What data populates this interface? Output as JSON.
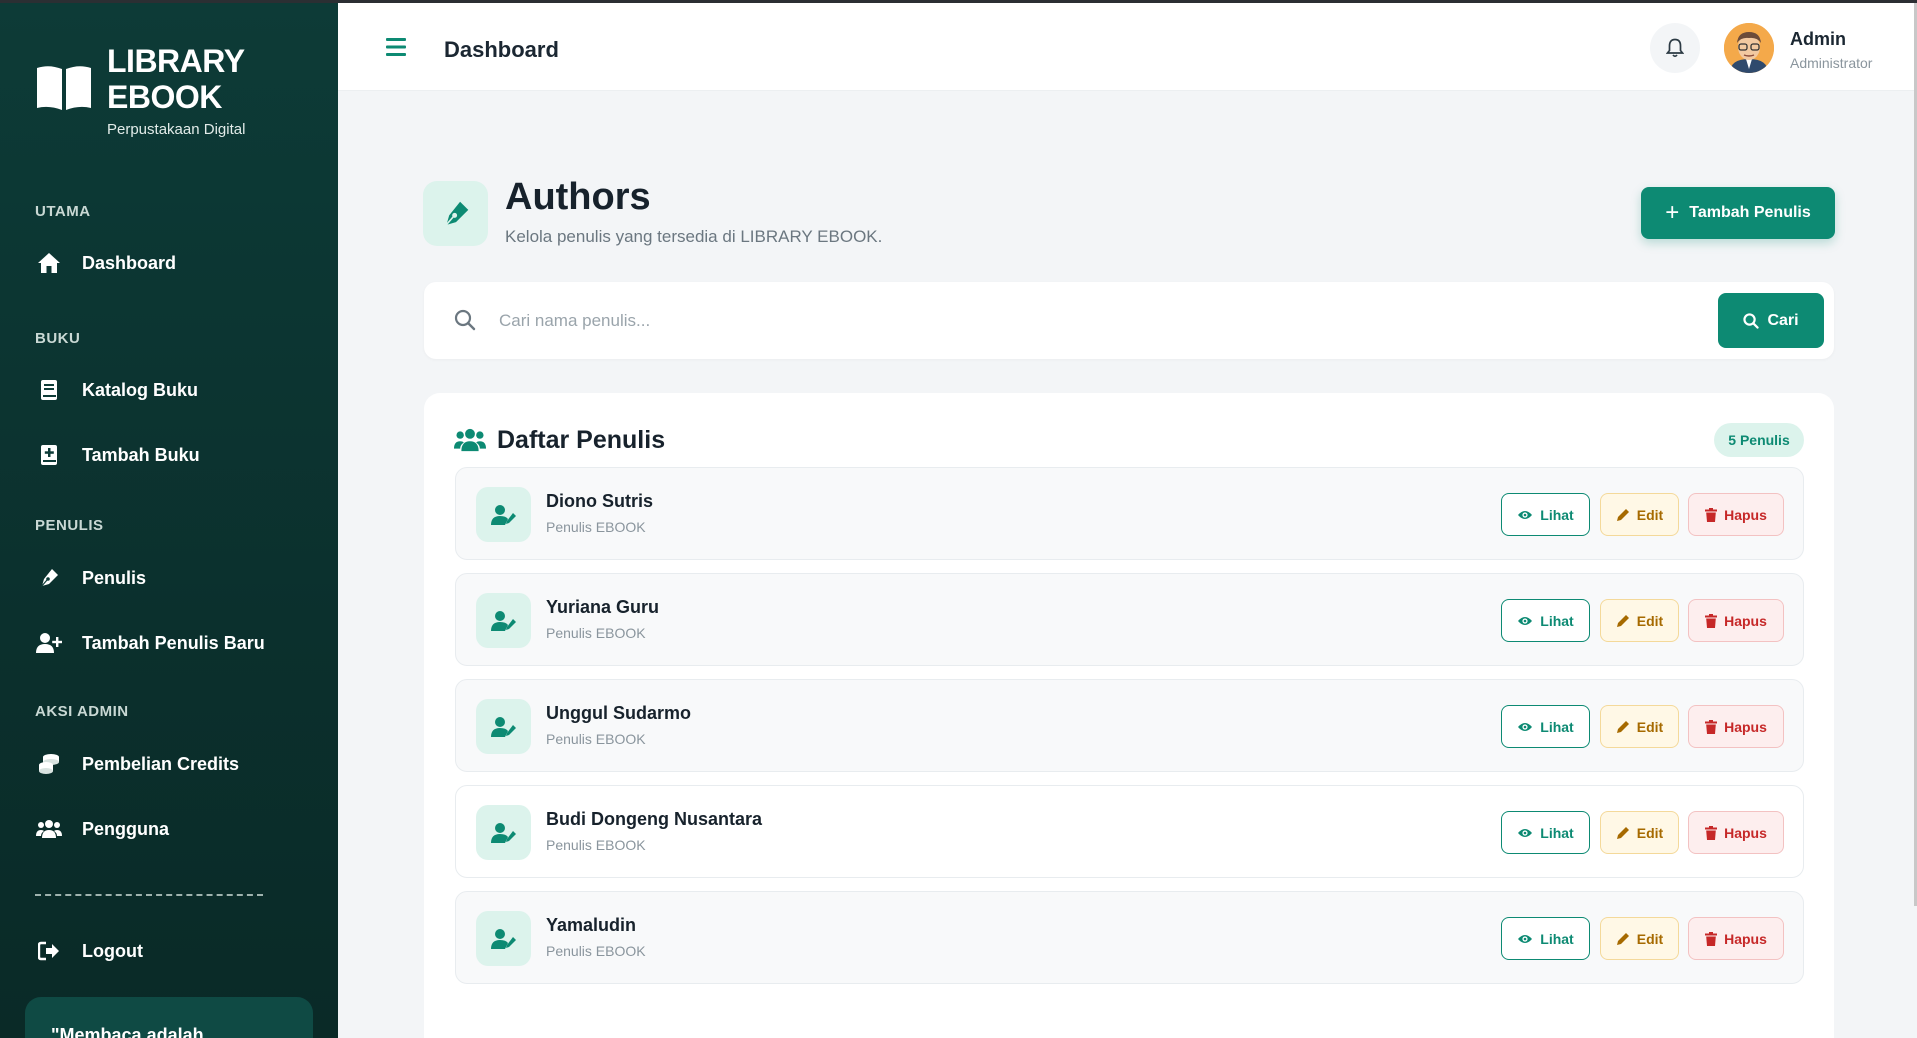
{
  "brand": {
    "title": "LIBRARY\nEBOOK",
    "subtitle": "Perpustakaan Digital"
  },
  "sidebar": {
    "sections": [
      {
        "label": "UTAMA"
      },
      {
        "label": "BUKU"
      },
      {
        "label": "PENULIS"
      },
      {
        "label": "AKSI ADMIN"
      }
    ],
    "items": [
      {
        "label": "Dashboard",
        "icon": "home-icon"
      },
      {
        "label": "Katalog Buku",
        "icon": "book-icon"
      },
      {
        "label": "Tambah Buku",
        "icon": "book-plus-icon"
      },
      {
        "label": "Penulis",
        "icon": "pen-nib-icon"
      },
      {
        "label": "Tambah Penulis Baru",
        "icon": "user-plus-icon"
      },
      {
        "label": "Pembelian Credits",
        "icon": "coins-icon"
      },
      {
        "label": "Pengguna",
        "icon": "users-icon"
      }
    ],
    "logout": "Logout",
    "quote": "\"Membaca adalah"
  },
  "header": {
    "title": "Dashboard",
    "user_name": "Admin",
    "user_role": "Administrator"
  },
  "page": {
    "title": "Authors",
    "subtitle": "Kelola penulis yang tersedia di LIBRARY EBOOK.",
    "add_button": "Tambah Penulis"
  },
  "search": {
    "placeholder": "Cari nama penulis...",
    "value": "",
    "button": "Cari"
  },
  "list": {
    "title": "Daftar Penulis",
    "count_badge": "5 Penulis",
    "view_label": "Lihat",
    "edit_label": "Edit",
    "delete_label": "Hapus",
    "authors": [
      {
        "name": "Diono Sutris",
        "role": "Penulis EBOOK"
      },
      {
        "name": "Yuriana Guru",
        "role": "Penulis EBOOK"
      },
      {
        "name": "Unggul Sudarmo",
        "role": "Penulis EBOOK"
      },
      {
        "name": "Budi Dongeng Nusantara",
        "role": "Penulis EBOOK"
      },
      {
        "name": "Yamaludin",
        "role": "Penulis EBOOK"
      }
    ]
  },
  "colors": {
    "sidebar": "#0d3b37",
    "accent": "#0d8a73",
    "edit": "#a66a00",
    "delete": "#c62828"
  }
}
